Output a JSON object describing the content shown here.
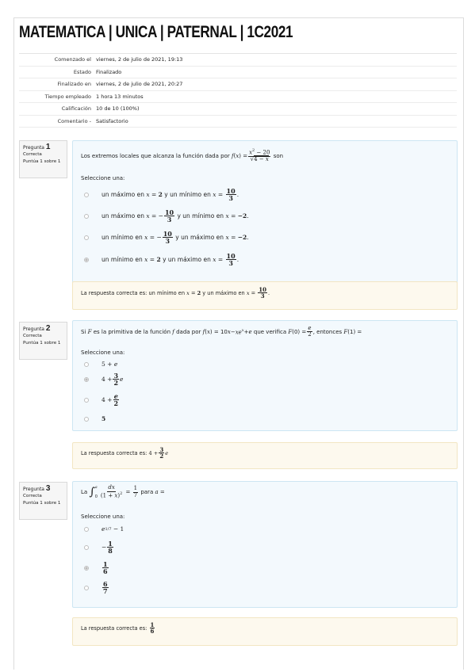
{
  "title": "MATEMATICA | UNICA | PATERNAL | 1C2021",
  "summary": [
    {
      "label": "Comenzado el",
      "value": "viernes, 2 de julio de 2021, 19:13"
    },
    {
      "label": "Estado",
      "value": "Finalizado"
    },
    {
      "label": "Finalizado en",
      "value": "viernes, 2 de julio de 2021, 20:27"
    },
    {
      "label": "Tiempo empleado",
      "value": "1 hora 13 minutos"
    },
    {
      "label": "Calificación",
      "value": "10 de 10 (100%)"
    },
    {
      "label": "Comentario -",
      "value": "Satisfactorio"
    }
  ],
  "select_one": "Seleccione una:",
  "answer_prefix": "La respuesta correcta es:",
  "questions": [
    {
      "word": "Pregunta",
      "num": "1",
      "status": "Correcta",
      "score": "Puntúa 1 sobre 1",
      "text_a": "Los extremos locales que alcanza la función dada por",
      "text_b": "son",
      "opt_words": {
        "a1": "un máximo en",
        "a2": "y un mínimo en",
        "b1": "un máximo en",
        "b2": "y un mínimo en",
        "c1": "un mínimo en",
        "c2": "y un máximo en",
        "d1": "un mínimo en",
        "d2": "y un máximo en"
      },
      "selected": 3,
      "answer_a": "un mínimo en",
      "answer_b": "y un máximo en"
    },
    {
      "word": "Pregunta",
      "num": "2",
      "status": "Correcta",
      "score": "Puntúa 1 sobre 1",
      "text_a": "Si",
      "text_b": "es la primitiva de la función",
      "text_c": "dada por",
      "text_d": "que verifica",
      "text_e": ", entonces",
      "selected": 1
    },
    {
      "word": "Pregunta",
      "num": "3",
      "status": "Correcta",
      "score": "Puntúa 1 sobre 1",
      "text_a": "La",
      "text_b": "para",
      "selected": 2
    }
  ]
}
